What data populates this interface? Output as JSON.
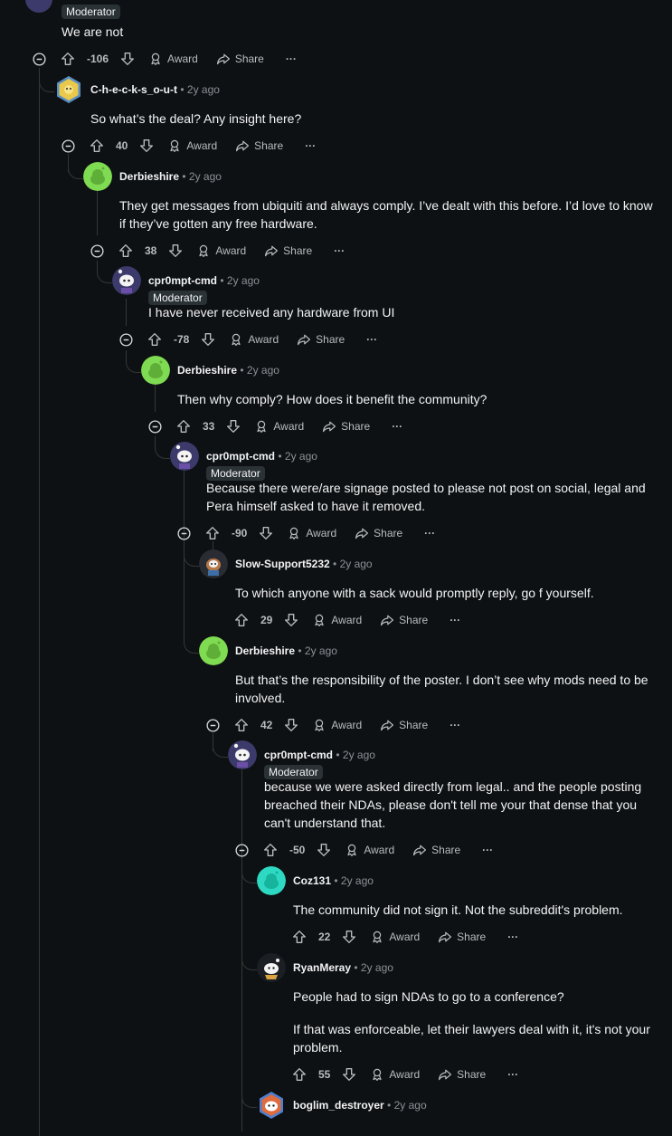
{
  "top": {
    "badge": "Moderator",
    "body": "We are not",
    "score": "-106"
  },
  "labels": {
    "award": "Award",
    "share": "Share",
    "more": "···",
    "moderator": "Moderator",
    "sep": "•"
  },
  "comments": [
    {
      "author": "C-h-e-c-k-s_o-u-t",
      "time": "2y ago",
      "body": [
        "So what’s the deal? Any insight here?"
      ],
      "score": "40",
      "avatar": "hex-gold-icon"
    },
    {
      "author": "Derbieshire",
      "time": "2y ago",
      "body": [
        "They get messages from ubiquiti and always comply. I’ve dealt with this before. I’d love to know if they’ve gotten any free hardware."
      ],
      "score": "38",
      "avatar": "green-snoo-icon"
    },
    {
      "author": "cpr0mpt-cmd",
      "time": "2y ago",
      "moderator": true,
      "body": [
        "I have never received any hardware from UI"
      ],
      "score": "-78",
      "avatar": "snoo-pirate-icon"
    },
    {
      "author": "Derbieshire",
      "time": "2y ago",
      "body": [
        "Then why comply? How does it benefit the community?"
      ],
      "score": "33",
      "avatar": "green-snoo-icon"
    },
    {
      "author": "cpr0mpt-cmd",
      "time": "2y ago",
      "moderator": true,
      "body": [
        "Because there were/are signage posted to please not post on social, legal and Pera himself asked to have it removed."
      ],
      "score": "-90",
      "avatar": "snoo-pirate-icon"
    },
    {
      "author": "Slow-Support5232",
      "time": "2y ago",
      "body": [
        "To which anyone with a sack would promptly reply, go f yourself."
      ],
      "score": "29",
      "avatar": "snoo-brown-icon"
    },
    {
      "author": "Derbieshire",
      "time": "2y ago",
      "body": [
        "But that’s the responsibility of the poster. I don’t see why mods need to be involved."
      ],
      "score": "42",
      "avatar": "green-snoo-icon"
    },
    {
      "author": "cpr0mpt-cmd",
      "time": "2y ago",
      "moderator": true,
      "body": [
        "because we were asked directly from legal.. and the people posting breached their NDAs, please don't tell me your that dense that you can't understand that."
      ],
      "score": "-50",
      "avatar": "snoo-pirate-icon"
    },
    {
      "author": "Coz131",
      "time": "2y ago",
      "body": [
        "The community did not sign it. Not the subreddit's problem."
      ],
      "score": "22",
      "avatar": "teal-snoo-icon"
    },
    {
      "author": "RyanMeray",
      "time": "2y ago",
      "body": [
        "People had to sign NDAs to go to a conference?",
        "If that was enforceable, let their lawyers deal with it, it's not your problem."
      ],
      "score": "55",
      "avatar": "snoo-sailor-icon"
    },
    {
      "author": "boglim_destroyer",
      "time": "2y ago",
      "body": [],
      "score": "",
      "avatar": "hex-snoo-icon"
    }
  ]
}
